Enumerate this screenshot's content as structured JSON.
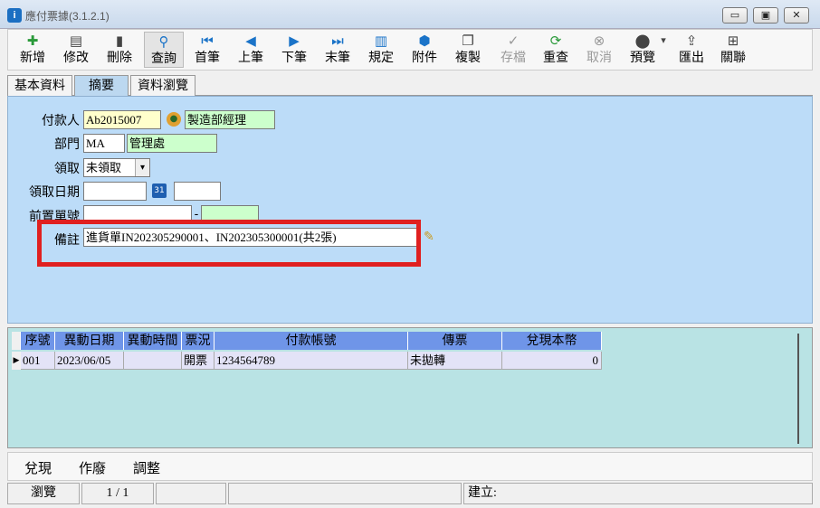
{
  "window": {
    "title": "應付票據(3.1.2.1)",
    "app_icon_text": "i",
    "controls": {
      "minimize": "▭",
      "maximize": "▣",
      "close": "✕"
    }
  },
  "toolbar": {
    "items": [
      {
        "label": "新增",
        "icon": "new-doc-icon",
        "glyph": "✚"
      },
      {
        "label": "修改",
        "icon": "edit-icon",
        "glyph": "▤"
      },
      {
        "label": "刪除",
        "icon": "trash-icon",
        "glyph": "▮"
      },
      {
        "label": "查詢",
        "icon": "search-icon",
        "glyph": "⚲"
      },
      {
        "label": "首筆",
        "icon": "first-record-icon",
        "glyph": "⏮"
      },
      {
        "label": "上筆",
        "icon": "prev-record-icon",
        "glyph": "◀"
      },
      {
        "label": "下筆",
        "icon": "next-record-icon",
        "glyph": "▶"
      },
      {
        "label": "末筆",
        "icon": "last-record-icon",
        "glyph": "⏭"
      },
      {
        "label": "規定",
        "icon": "book-icon",
        "glyph": "▥"
      },
      {
        "label": "附件",
        "icon": "attachment-icon",
        "glyph": "⬢"
      },
      {
        "label": "複製",
        "icon": "copy-icon",
        "glyph": "❐"
      },
      {
        "label": "存檔",
        "icon": "save-icon",
        "glyph": "✓"
      },
      {
        "label": "重查",
        "icon": "refresh-icon",
        "glyph": "⟳"
      },
      {
        "label": "取消",
        "icon": "cancel-icon",
        "glyph": "⊗"
      },
      {
        "label": "預覽",
        "icon": "preview-icon",
        "glyph": "⬤"
      },
      {
        "label": "匯出",
        "icon": "export-icon",
        "glyph": "⇪"
      },
      {
        "label": "關聯",
        "icon": "relation-icon",
        "glyph": "⊞"
      }
    ],
    "dropdown_arrow": "▾"
  },
  "tabs": [
    {
      "label": "基本資料"
    },
    {
      "label": "摘要"
    },
    {
      "label": "資料瀏覽"
    }
  ],
  "form": {
    "payer_label": "付款人",
    "payer_code": "Ab2015007",
    "payer_name": "製造部經理",
    "dept_label": "部門",
    "dept_code": "MA",
    "dept_name": "管理處",
    "receive_label": "領取",
    "receive_value": "未領取",
    "receive_date_label": "領取日期",
    "receive_date_value": "",
    "receive_time_value": "",
    "calendar_text": "31",
    "prev_doc_label": "前置單號",
    "prev_doc_value": "",
    "prev_doc_sep": "-",
    "prev_doc_suffix": "",
    "remark_label": "備註",
    "remark_value": "進貨單IN202305290001、IN202305300001(共2張)"
  },
  "grid": {
    "columns": [
      "序號",
      "異動日期",
      "異動時間",
      "票況",
      "付款帳號",
      "傳票",
      "兌現本幣"
    ],
    "rows": [
      [
        "001",
        "2023/06/05",
        "",
        "開票",
        "1234564789",
        "未拋轉",
        "0"
      ]
    ],
    "row_marker": "▶"
  },
  "actions": [
    "兌現",
    "作廢",
    "調整"
  ],
  "status": {
    "mode": "瀏覽",
    "record": "1 / 1",
    "created": "建立:"
  },
  "colors": {
    "form_bg": "#bcdcf8",
    "grid_bg": "#b9e3e4",
    "grid_header": "#6f95e8",
    "highlight": "#e02020"
  }
}
